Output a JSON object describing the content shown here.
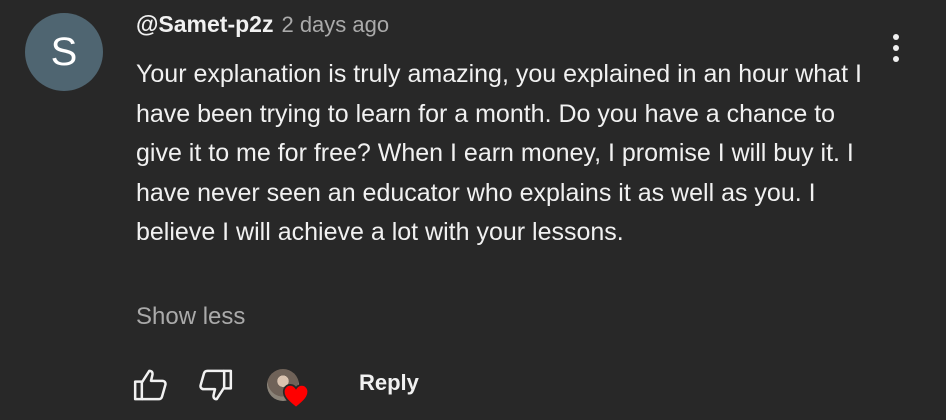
{
  "comment": {
    "avatar_letter": "S",
    "author": "@Samet-p2z",
    "time": "2 days ago",
    "text": "Your explanation is truly amazing, you explained in an hour what I have been trying to learn for a month. Do you have a chance to give it to me for free? When I earn money, I promise I will buy it. I have never seen an educator who explains it as well as you. I believe I will achieve a lot with your lessons.",
    "show_less_label": "Show less"
  },
  "actions": {
    "like_icon": "thumbs-up-icon",
    "dislike_icon": "thumbs-down-icon",
    "creator_heart_icon": "heart-icon",
    "reply_label": "Reply"
  },
  "menu": {
    "icon": "more-vertical-icon"
  },
  "colors": {
    "background": "#282828",
    "text_primary": "#f1f1f1",
    "text_secondary": "#aaaaaa",
    "avatar_bg": "#4f6571",
    "heart": "#ff0000"
  }
}
